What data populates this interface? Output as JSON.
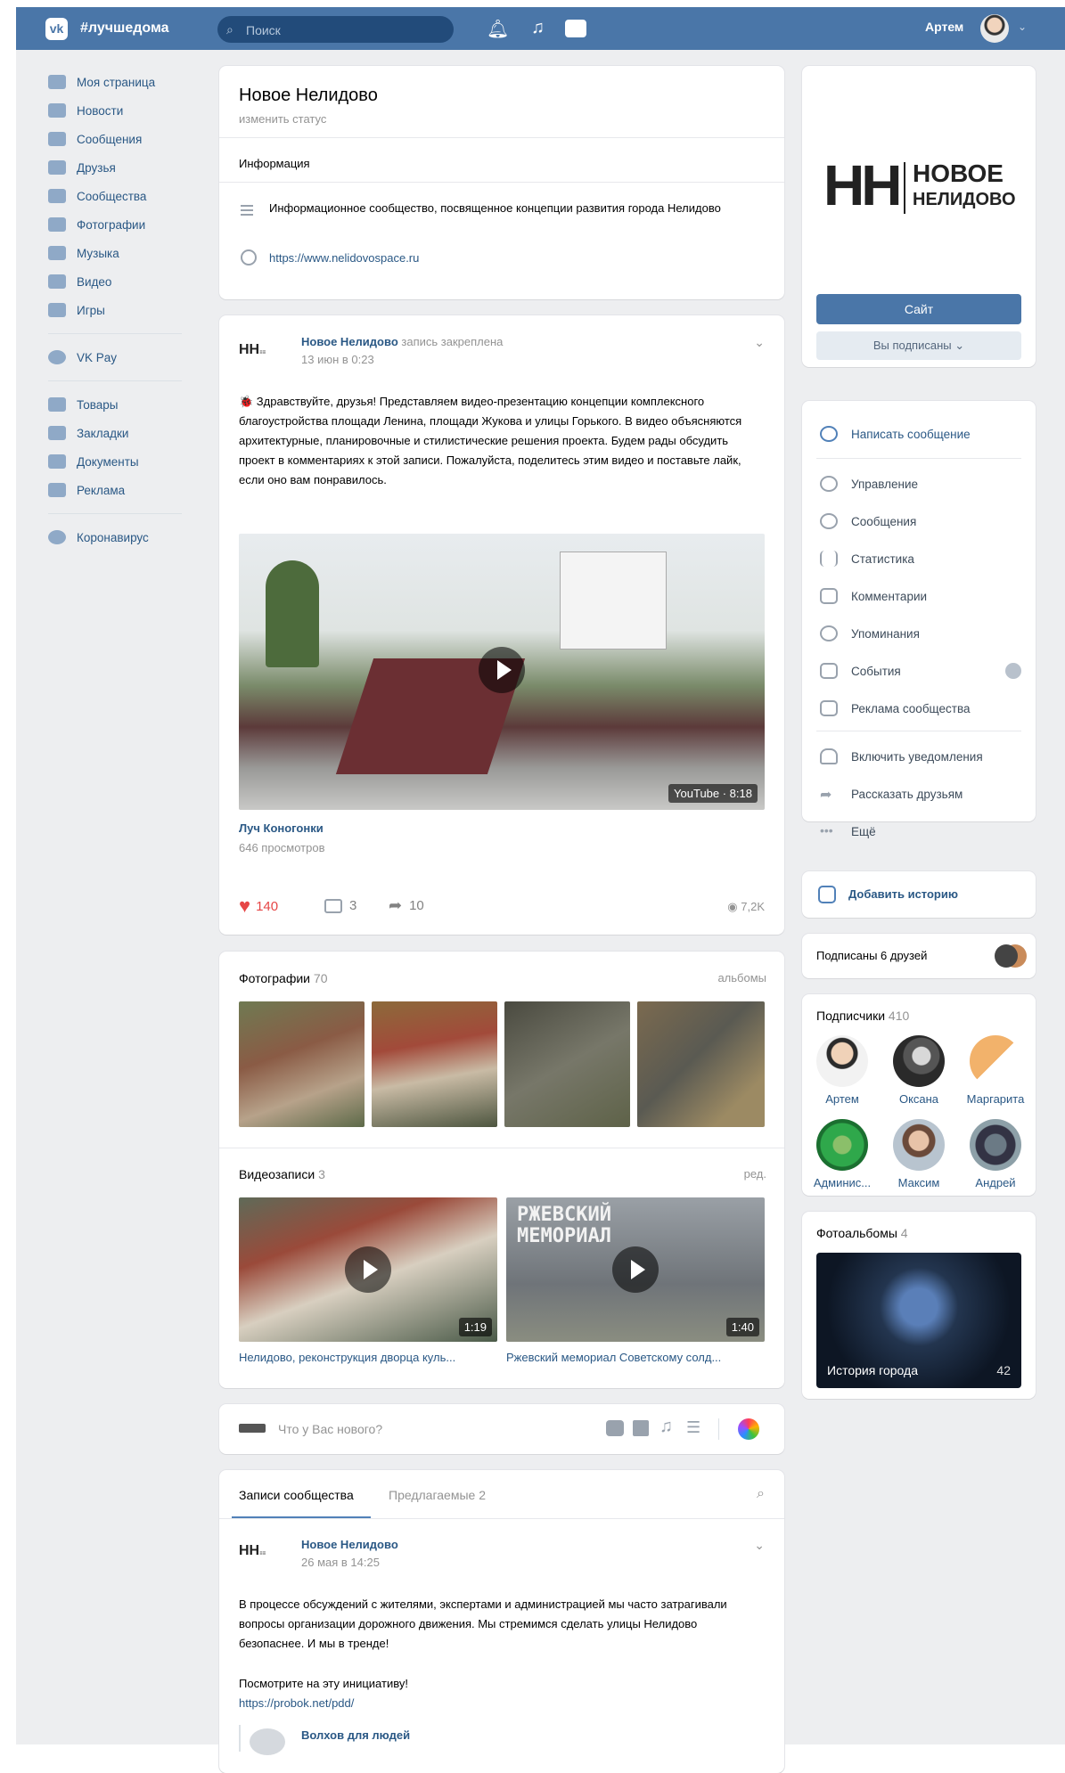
{
  "header": {
    "brand": "#лучшедома",
    "search_placeholder": "Поиск",
    "user_name": "Артем"
  },
  "nav": {
    "items": [
      {
        "label": "Моя страница",
        "icon": "home-icon"
      },
      {
        "label": "Новости",
        "icon": "news-icon"
      },
      {
        "label": "Сообщения",
        "icon": "messages-icon"
      },
      {
        "label": "Друзья",
        "icon": "friends-icon"
      },
      {
        "label": "Сообщества",
        "icon": "communities-icon"
      },
      {
        "label": "Фотографии",
        "icon": "camera-icon"
      },
      {
        "label": "Музыка",
        "icon": "music-icon"
      },
      {
        "label": "Видео",
        "icon": "video-icon"
      },
      {
        "label": "Игры",
        "icon": "games-icon"
      },
      {
        "label": "VK Pay",
        "icon": "vkpay-icon"
      },
      {
        "label": "Товары",
        "icon": "goods-icon"
      },
      {
        "label": "Закладки",
        "icon": "star-icon"
      },
      {
        "label": "Документы",
        "icon": "documents-icon"
      },
      {
        "label": "Реклама",
        "icon": "ads-icon"
      },
      {
        "label": "Коронавирус",
        "icon": "virus-icon"
      }
    ]
  },
  "group": {
    "name": "Новое Нелидово",
    "status_placeholder": "изменить статус",
    "info_title": "Информация",
    "description": "Информационное сообщество, посвященное концепции развития города Нелидово",
    "website": "https://www.nelidovospace.ru",
    "logo_letters": "НН",
    "logo_line1": "НОВОЕ",
    "logo_line2": "НЕЛИДОВО"
  },
  "pinned_post": {
    "author": "Новое Нелидово",
    "pinned_note": "запись закреплена",
    "date": "13 июн в 0:23",
    "text": "🐞 Здравствуйте, друзья! Представляем видео-презентацию концепции комплексного благоустройства площади Ленина, площади Жукова и улицы Горького. В видео объясняются архитектурные, планировочные и стилистические решения проекта. Будем рады обсудить проект в комментариях к этой записи. Пожалуйста, поделитесь этим видео и поставьте лайк, если оно вам понравилось.",
    "video_badge": "YouTube · 8:18",
    "video_title": "Луч Коногонки",
    "video_views": "646 просмотров",
    "likes": "140",
    "comments": "3",
    "shares": "10",
    "views": "7,2K"
  },
  "photos": {
    "title": "Фотографии",
    "count": "70",
    "link": "альбомы"
  },
  "videos": {
    "title": "Видеозаписи",
    "count": "3",
    "link": "ред.",
    "items": [
      {
        "title": "Нелидово, реконструкция дворца куль...",
        "duration": "1:19"
      },
      {
        "title": "Ржевский мемориал Советскому солд...",
        "duration": "1:40",
        "overlay": "РЖЕВСКИЙ МЕМОРИАЛ"
      }
    ]
  },
  "composer": {
    "placeholder": "Что у Вас нового?"
  },
  "wall": {
    "tab_active": "Записи сообщества",
    "tab_other": "Предлагаемые",
    "tab_other_count": "2",
    "post": {
      "author": "Новое Нелидово",
      "date": "26 мая в 14:25",
      "text": "В процессе обсуждений с жителями, экспертами и администрацией мы часто затрагивали вопросы организации дорожного движения. Мы стремимся сделать улицы Нелидово безопаснее. И мы в тренде!",
      "text2": "Посмотрите на эту инициативу!",
      "link": "https://probok.net/pdd/",
      "repost_author": "Волхов для людей"
    }
  },
  "sidebar": {
    "site_button": "Сайт",
    "subscribed_button": "Вы подписаны ⌄",
    "write_message": "Написать сообщение",
    "menu": [
      {
        "label": "Управление",
        "icon": "gear-icon"
      },
      {
        "label": "Сообщения",
        "icon": "chat-icon"
      },
      {
        "label": "Статистика",
        "icon": "stats-icon"
      },
      {
        "label": "Комментарии",
        "icon": "comments-icon"
      },
      {
        "label": "Упоминания",
        "icon": "at-icon"
      },
      {
        "label": "События",
        "icon": "events-icon"
      },
      {
        "label": "Реклама сообщества",
        "icon": "megaphone-icon"
      },
      {
        "label": "Включить уведомления",
        "icon": "bell-icon"
      },
      {
        "label": "Рассказать друзьям",
        "icon": "share-icon"
      },
      {
        "label": "Ещё",
        "icon": "more-icon"
      }
    ],
    "add_story": "Добавить историю",
    "friends_subscribed": "Подписаны 6 друзей",
    "followers_title": "Подписчики",
    "followers_count": "410",
    "followers": [
      "Артем",
      "Оксана",
      "Маргарита",
      "Админис...",
      "Максим",
      "Андрей"
    ],
    "albums_title": "Фотоальбомы",
    "albums_count": "4",
    "album_name": "История города",
    "album_count": "42"
  }
}
